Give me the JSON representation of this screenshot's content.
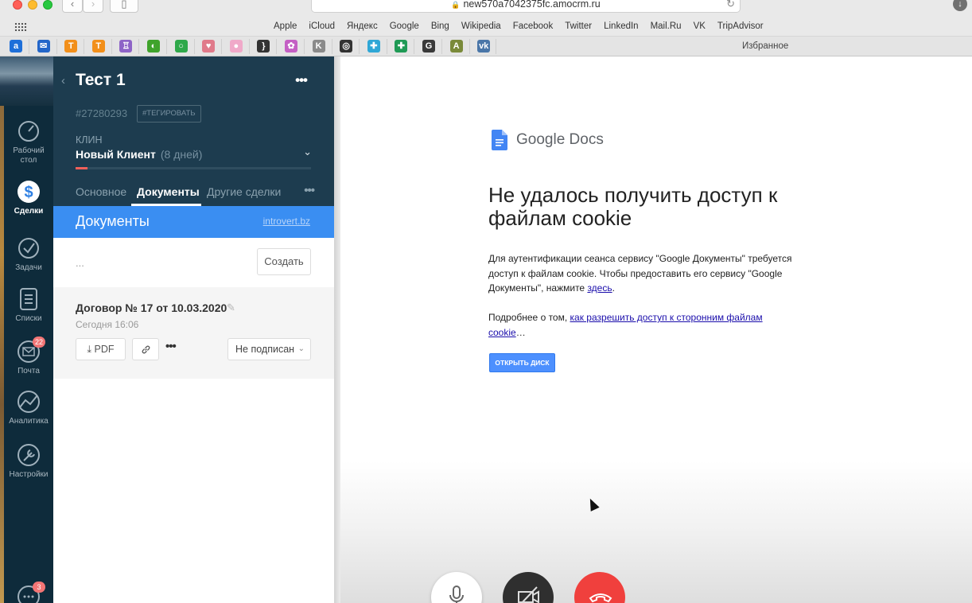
{
  "browser": {
    "url": "new570a7042375fc.amocrm.ru",
    "favorites": [
      "Apple",
      "iCloud",
      "Яндекс",
      "Google",
      "Bing",
      "Wikipedia",
      "Facebook",
      "Twitter",
      "LinkedIn",
      "Mail.Ru",
      "VK",
      "TripAdvisor"
    ],
    "favorites_label": "Избранное",
    "extension_icons": [
      {
        "name": "amocrm-ext-icon",
        "glyph": "a",
        "color": "#1e6fd9"
      },
      {
        "name": "mail-ext-icon",
        "glyph": "✉",
        "color": "#2366c9"
      },
      {
        "name": "t-orange-ext-icon",
        "glyph": "T",
        "color": "#f28f1a"
      },
      {
        "name": "t-orange-2-ext-icon",
        "glyph": "T",
        "color": "#f28f1a"
      },
      {
        "name": "purple-basket-ext-icon",
        "glyph": "♖",
        "color": "#8e64c7"
      },
      {
        "name": "green-leaf-ext-icon",
        "glyph": "◐",
        "color": "#3fa32b"
      },
      {
        "name": "green-ring-ext-icon",
        "glyph": "○",
        "color": "#2fa84a"
      },
      {
        "name": "heart-ext-icon",
        "glyph": "♥",
        "color": "#e07a8a"
      },
      {
        "name": "pink-ext-icon",
        "glyph": "●",
        "color": "#f0a9c9"
      },
      {
        "name": "bracket-ext-icon",
        "glyph": "}",
        "color": "#333333"
      },
      {
        "name": "colorwheel-ext-icon",
        "glyph": "✿",
        "color": "#c45fc4"
      },
      {
        "name": "k-ext-icon",
        "glyph": "K",
        "color": "#8a8a8a"
      },
      {
        "name": "instagram-ext-icon",
        "glyph": "◎",
        "color": "#333333"
      },
      {
        "name": "puzzle-ext-icon",
        "glyph": "✚",
        "color": "#2fa7d6"
      },
      {
        "name": "sheets-ext-icon",
        "glyph": "✚",
        "color": "#1f9a55"
      },
      {
        "name": "gc-ext-icon",
        "glyph": "G",
        "color": "#3a3a3a"
      },
      {
        "name": "a-book-ext-icon",
        "glyph": "A",
        "color": "#7a8a3a"
      },
      {
        "name": "vk-ext-icon",
        "glyph": "vk",
        "color": "#4a76a8"
      }
    ]
  },
  "nav": {
    "items": [
      {
        "label": "Рабочий стол",
        "icon": "dashboard-icon",
        "active": false
      },
      {
        "label": "Сделки",
        "icon": "deals-icon",
        "active": true
      },
      {
        "label": "Задачи",
        "icon": "tasks-icon",
        "active": false
      },
      {
        "label": "Списки",
        "icon": "lists-icon",
        "active": false
      },
      {
        "label": "Почта",
        "icon": "mail-icon",
        "active": false,
        "badge": "22"
      },
      {
        "label": "Аналитика",
        "icon": "analytics-icon",
        "active": false
      },
      {
        "label": "Настройки",
        "icon": "settings-icon",
        "active": false
      }
    ],
    "chat_badge": "3"
  },
  "lead": {
    "title": "Тест 1",
    "id": "#27280293",
    "tag_label": "#ТЕГИРОВАТЬ",
    "pipeline": "КЛИН",
    "status": "Новый Клиент",
    "status_age": "(8 дней)",
    "stage_progress": 0.05,
    "tabs": [
      "Основное",
      "Документы",
      "Другие сделки"
    ],
    "active_tab": "Документы"
  },
  "documents": {
    "title": "Документы",
    "provider_link": "introvert.bz",
    "ellipsis": "...",
    "create_label": "Создать",
    "item": {
      "name": "Договор № 17 от 10.03.2020",
      "date": "Сегодня 16:06",
      "pdf_label": "PDF",
      "status": "Не подписан"
    }
  },
  "gdocs": {
    "brand": "Google Docs",
    "heading": "Не удалось получить доступ к файлам cookie",
    "p1_text": "Для аутентификации сеанса сервису \"Google Документы\" требуется доступ к файлам cookie. Чтобы предоставить его сервису \"Google Документы\", нажмите ",
    "p1_link": "здесь",
    "p1_end": ".",
    "p2_text": "Подробнее о том, ",
    "p2_link": "как разрешить доступ к сторонним файлам cookie",
    "p2_end": "…",
    "button_label": "ОТКРЫТЬ ДИСК"
  },
  "colors": {
    "rail_bg": "#0e2b3b",
    "header_bg": "#1d3c4f",
    "docs_bar": "#3a8ef2",
    "progress_red": "#f0605a",
    "call_end_red": "#f0403d"
  }
}
